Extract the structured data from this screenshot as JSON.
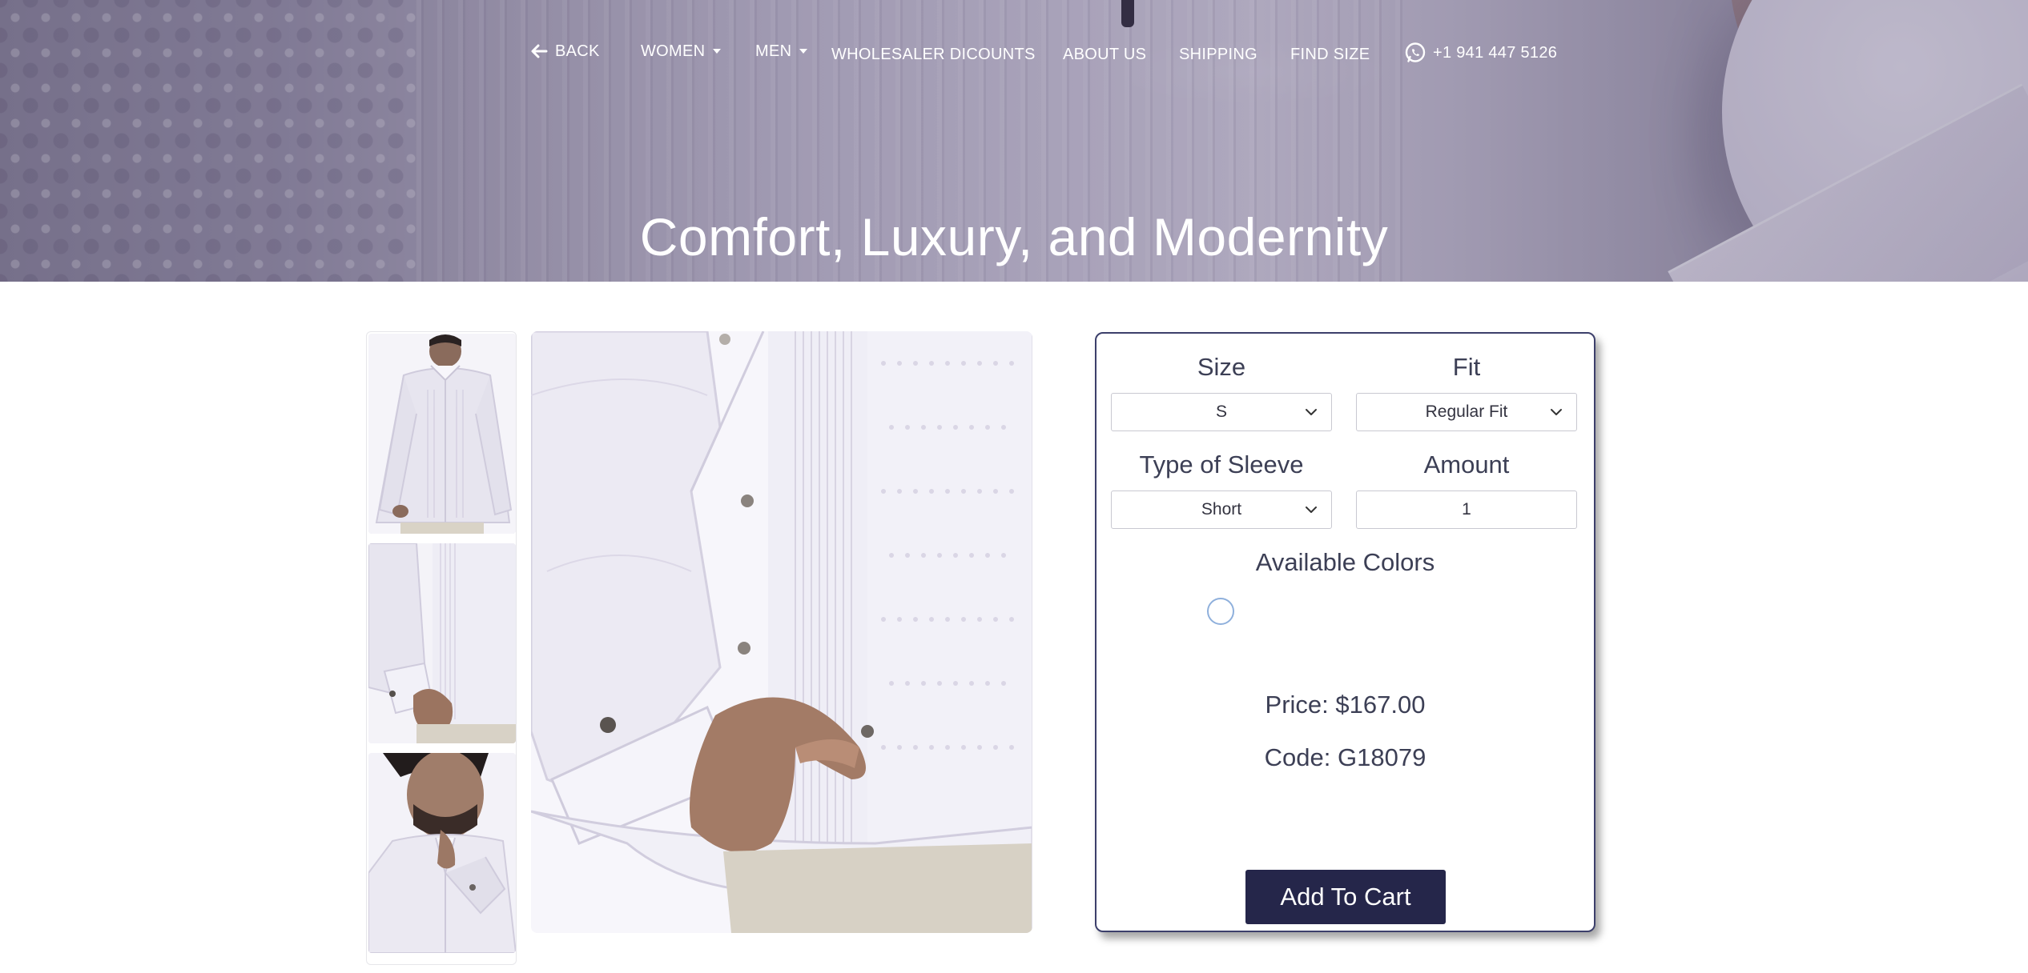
{
  "nav": {
    "back_label": "BACK",
    "women_label": "WOMEN",
    "men_label": "MEN",
    "wholesaler_label": "WHOLESALER DICOUNTS",
    "about_label": "ABOUT US",
    "shipping_label": "SHIPPING",
    "find_size_label": "FIND SIZE",
    "phone_label": "+1 941 447 5126"
  },
  "hero": {
    "title": "Comfort, Luxury, and Modernity"
  },
  "options": {
    "size_label": "Size",
    "size_value": "S",
    "fit_label": "Fit",
    "fit_value": "Regular Fit",
    "sleeve_label": "Type of Sleeve",
    "sleeve_value": "Short",
    "amount_label": "Amount",
    "amount_value": "1",
    "colors_label": "Available Colors",
    "price_text": "Price: $167.00",
    "code_text": "Code: G18079",
    "add_to_cart_label": "Add To Cart"
  },
  "colors": {
    "nav_text": "#ffffff",
    "button_bg": "#25264a",
    "panel_border": "#3c3f6b",
    "swatch_ring": "#8fb0dc"
  },
  "icons": [
    "arrow-left-icon",
    "caret-down-icon",
    "whatsapp-icon",
    "chevron-down-icon"
  ]
}
